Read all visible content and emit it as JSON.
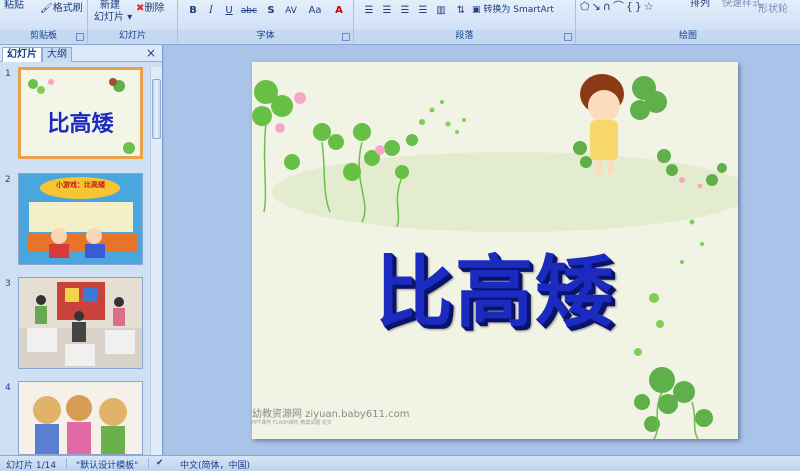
{
  "ribbon": {
    "clipboard": {
      "paste": "粘贴",
      "format_painter": "格式刷",
      "label": "剪贴板"
    },
    "slides": {
      "new_slide_1": "新建",
      "new_slide_2": "幻灯片",
      "delete": "删除",
      "label": "幻灯片"
    },
    "font": {
      "bold": "B",
      "italic": "I",
      "underline": "U",
      "strike": "abc",
      "shadow": "S",
      "spacing": "AV",
      "case": "Aa",
      "label": "字体"
    },
    "paragraph": {
      "smartart": "转换为 SmartArt",
      "label": "段落"
    },
    "drawing": {
      "arrange": "排列",
      "quick_styles": "快速样式",
      "shape_outline": "形状轮",
      "label": "绘图"
    }
  },
  "sidebar": {
    "tab_slides": "幻灯片",
    "tab_outline": "大纲",
    "close": "×",
    "thumbnails": [
      {
        "num": "1",
        "title": "比高矮"
      },
      {
        "num": "2",
        "title": "小游戏：比高矮"
      },
      {
        "num": "3"
      },
      {
        "num": "4"
      }
    ]
  },
  "slide": {
    "title": "比高矮",
    "watermark": "幼教资源网 ziyuan.baby611.com",
    "watermark_small": "PPT课件  FLASH课件  教案试题  论文"
  },
  "status": {
    "slide_count": "幻灯片 1/14",
    "template": "\"默认设计模板\"",
    "language": "中文(简体，中国)"
  }
}
